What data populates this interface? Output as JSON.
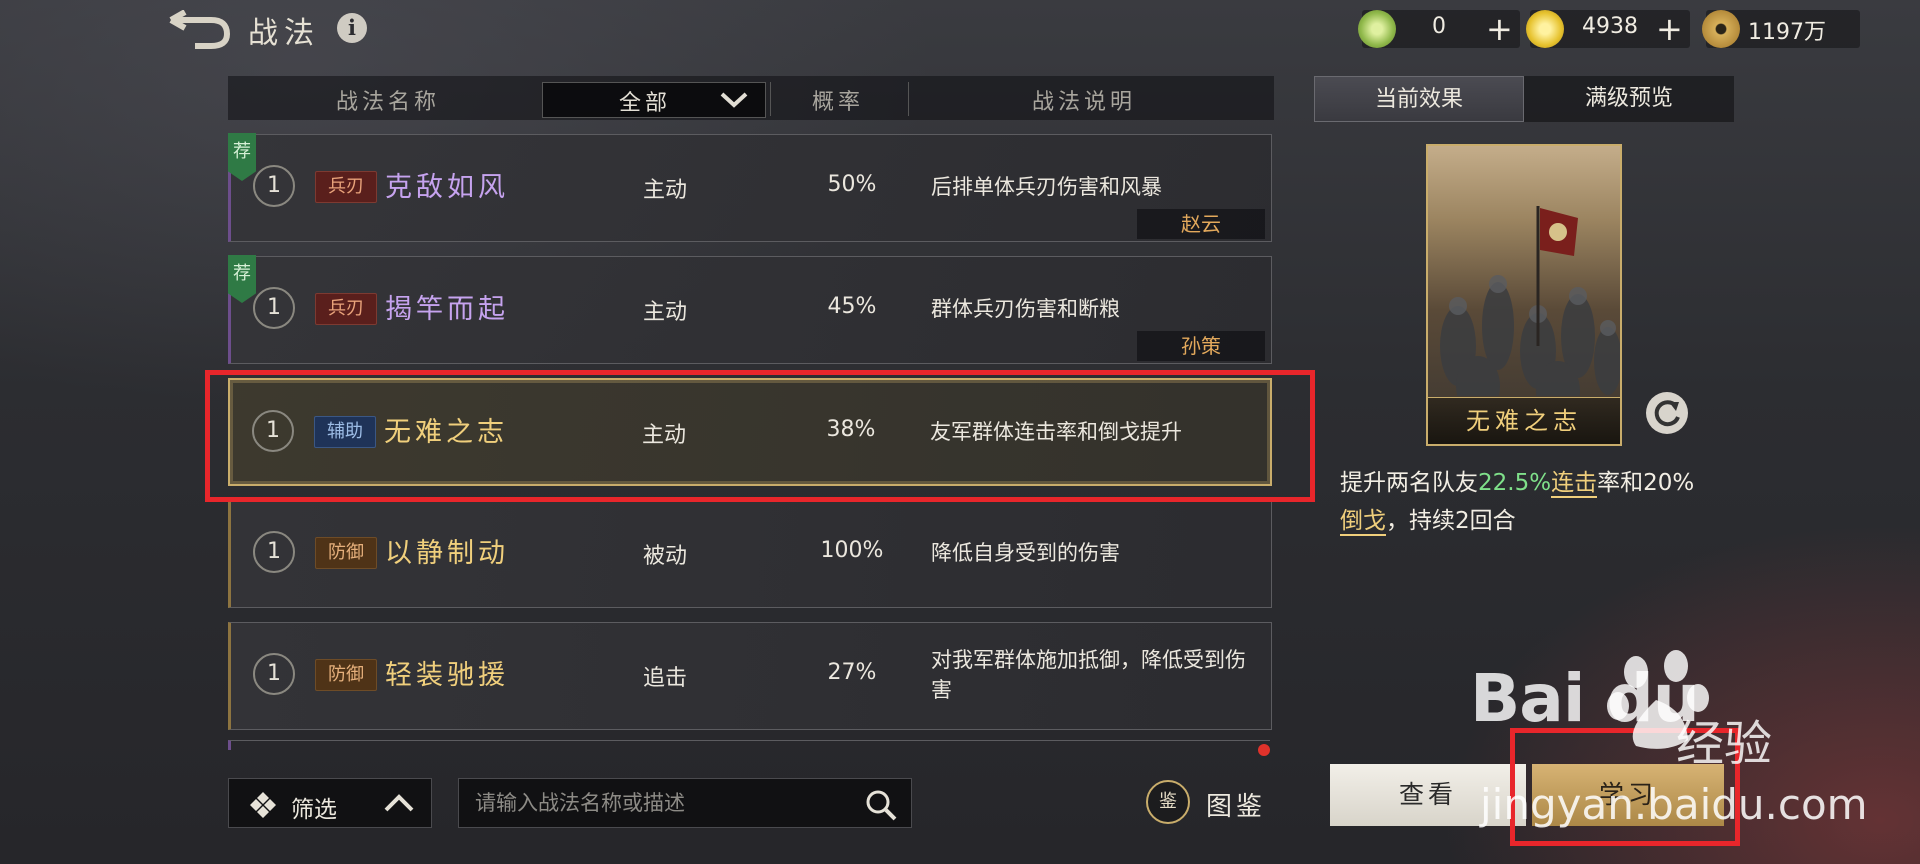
{
  "header": {
    "title": "战法",
    "info_icon": "i"
  },
  "resources": [
    {
      "icon": "jade-coin-icon",
      "value": "0",
      "has_plus": true
    },
    {
      "icon": "gold-coin-icon",
      "value": "4938",
      "has_plus": true
    },
    {
      "icon": "copper-coin-icon",
      "value": "1197万",
      "has_plus": false
    }
  ],
  "table": {
    "columns": {
      "name": "战法名称",
      "filter": "全部",
      "rate": "概率",
      "desc": "战法说明"
    },
    "rows": [
      {
        "level": "1",
        "tag": "兵刃",
        "tag_color": "red",
        "name": "克敌如风",
        "name_color": "purple",
        "type": "主动",
        "rate": "50%",
        "desc": "后排单体兵刃伤害和风暴",
        "recommended": "荐",
        "owner": "赵云",
        "selected": false
      },
      {
        "level": "1",
        "tag": "兵刃",
        "tag_color": "red",
        "name": "揭竿而起",
        "name_color": "purple",
        "type": "主动",
        "rate": "45%",
        "desc": "群体兵刃伤害和断粮",
        "recommended": "荐",
        "owner": "孙策",
        "selected": false
      },
      {
        "level": "1",
        "tag": "辅助",
        "tag_color": "blue",
        "name": "无难之志",
        "name_color": "gold",
        "type": "主动",
        "rate": "38%",
        "desc": "友军群体连击率和倒戈提升",
        "recommended": "",
        "owner": "",
        "selected": true
      },
      {
        "level": "1",
        "tag": "防御",
        "tag_color": "brown",
        "name": "以静制动",
        "name_color": "gold",
        "type": "被动",
        "rate": "100%",
        "desc": "降低自身受到的伤害",
        "recommended": "",
        "owner": "",
        "selected": false
      },
      {
        "level": "1",
        "tag": "防御",
        "tag_color": "brown",
        "name": "轻装驰援",
        "name_color": "gold",
        "type": "追击",
        "rate": "27%",
        "desc": "对我军群体施加抵御，降低受到伤害",
        "recommended": "",
        "owner": "",
        "selected": false
      }
    ]
  },
  "bottom": {
    "filter_label": "筛选",
    "search_placeholder": "请输入战法名称或描述",
    "catalog_icon_text": "鉴",
    "catalog_label": "图鉴"
  },
  "panel": {
    "tabs": [
      "当前效果",
      "满级预览"
    ],
    "active_tab": 0,
    "card_name": "无难之志",
    "effect": {
      "p1": "提升两名队友",
      "pct1": "22.5%",
      "kw1": "连击",
      "p2": "率和20%",
      "kw2": "倒戈",
      "p3": "，持续2回合"
    },
    "view_button": "查看",
    "learn_button": "学习"
  },
  "watermark": {
    "logo": "Bai  du",
    "cn": "经验",
    "url": "jingyan.baidu.com"
  },
  "colors": {
    "accent_gold": "#c9ad6b",
    "highlight_red": "#e8262b",
    "rate_green": "#7fe08a"
  }
}
